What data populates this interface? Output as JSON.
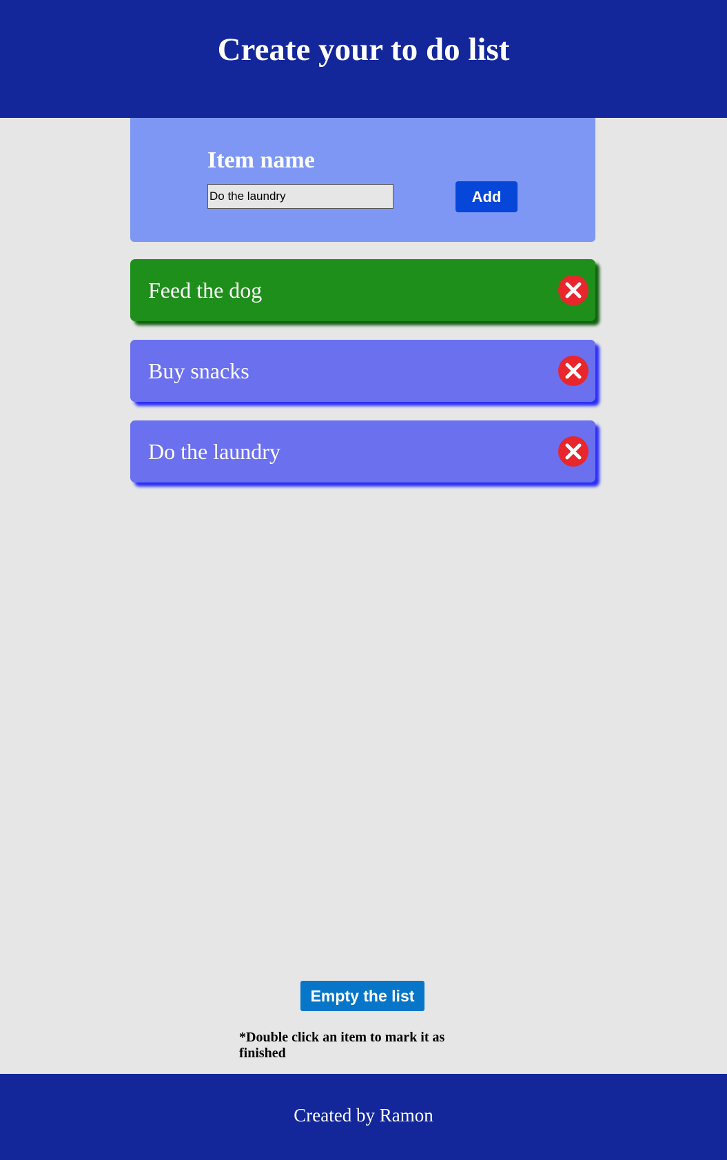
{
  "header": {
    "title": "Create your to do list"
  },
  "form": {
    "label": "Item name",
    "input_value": "Do the laundry",
    "add_label": "Add"
  },
  "items": [
    {
      "text": "Feed the dog",
      "status": "done"
    },
    {
      "text": "Buy snacks",
      "status": "pending"
    },
    {
      "text": "Do the laundry",
      "status": "pending"
    }
  ],
  "actions": {
    "empty_label": "Empty the list"
  },
  "hint": {
    "text": "*Double click an item to mark it as finished"
  },
  "footer": {
    "text": "Created by Ramon"
  },
  "colors": {
    "header_bg": "#13279b",
    "form_bg": "#7e97f4",
    "done_item": "#1f8f1b",
    "pending_item": "#6b70ef",
    "add_button": "#0646d8",
    "empty_button": "#0776c9",
    "delete_icon": "#e8262b",
    "page_bg": "#e6e6e6"
  }
}
